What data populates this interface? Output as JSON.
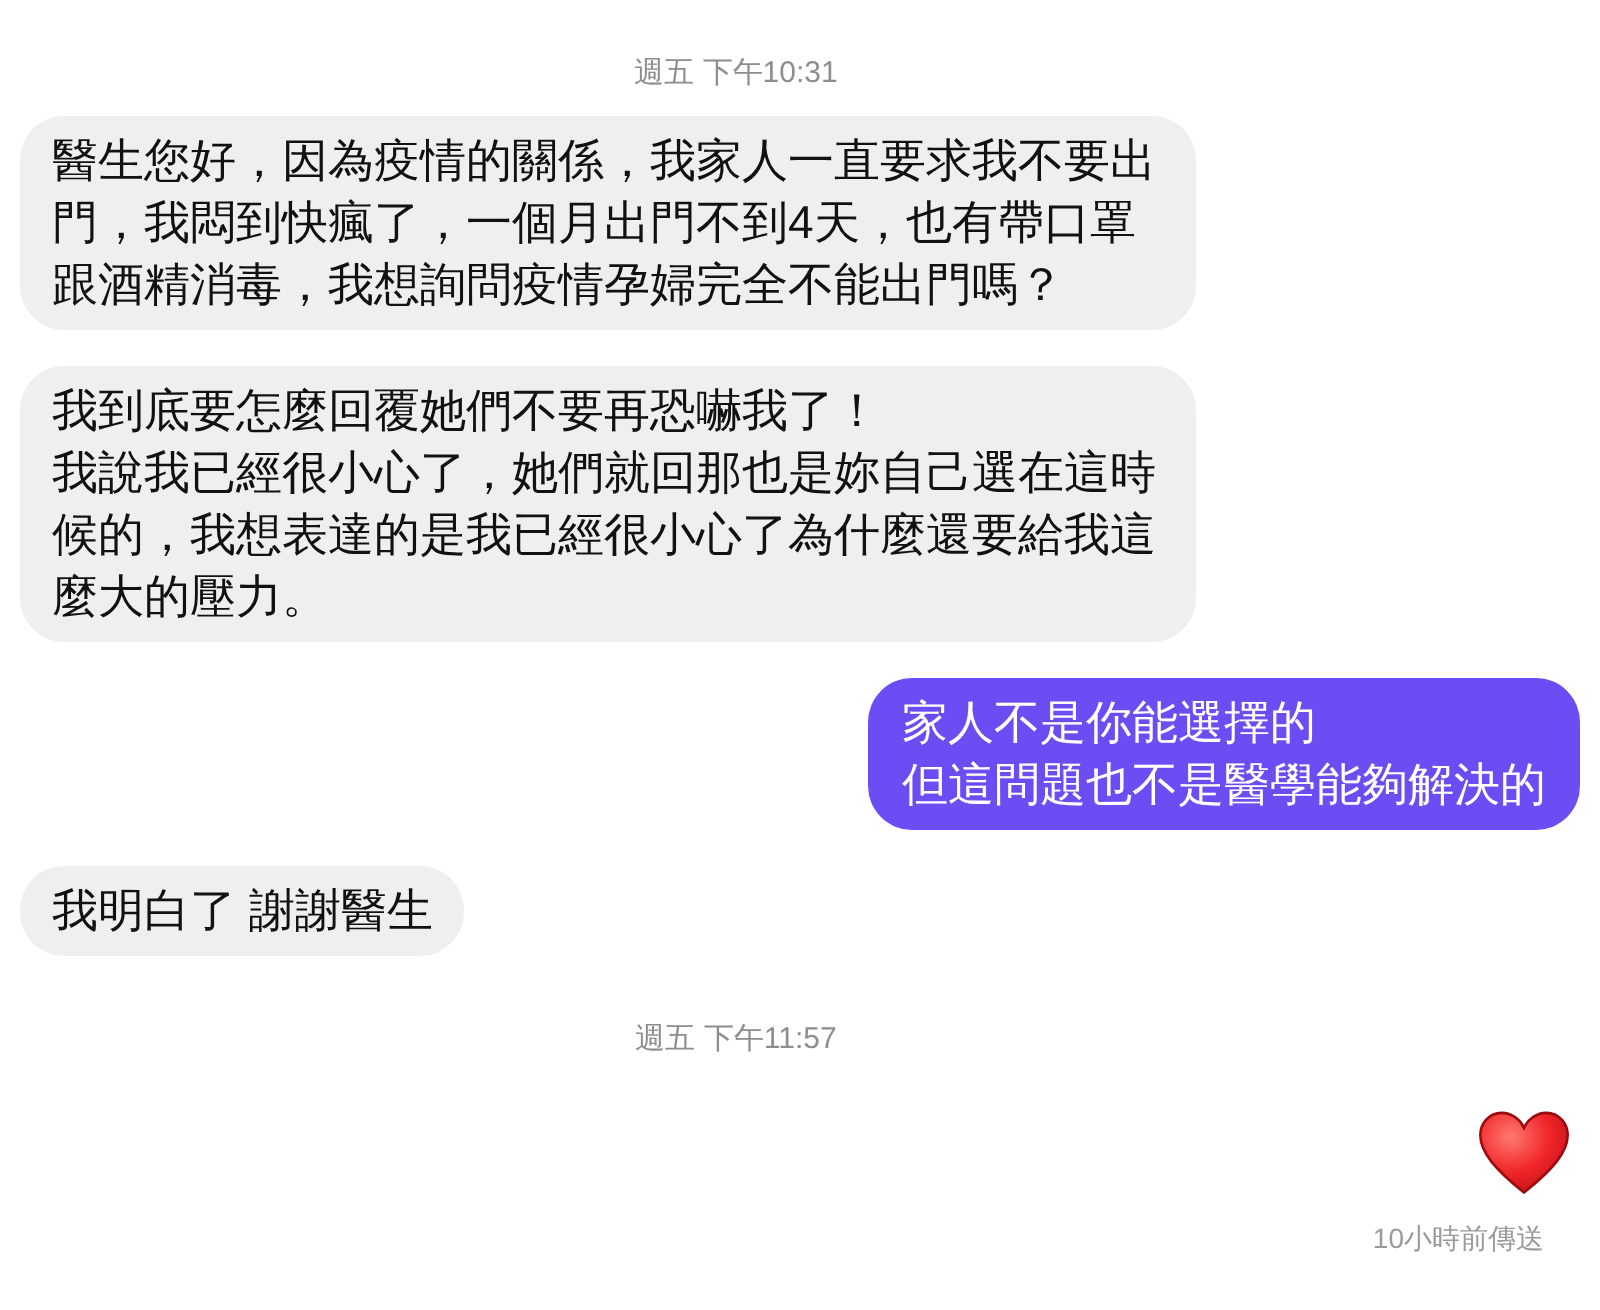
{
  "messages": [
    {
      "kind": "timestamp",
      "text": "週五 下午10:31"
    },
    {
      "kind": "received",
      "lines": [
        "醫生您好，因為疫情的關係，我家人一直要求我不要出門，我悶到快瘋了，一個月出門不到4天，也有帶口罩跟酒精消毒，我想詢問疫情孕婦完全不能出門嗎？"
      ]
    },
    {
      "kind": "received",
      "lines": [
        "我到底要怎麼回覆她們不要再恐嚇我了！",
        "我說我已經很小心了，她們就回那也是妳自己選在這時候的，我想表達的是我已經很小心了為什麼還要給我這麼大的壓力。"
      ]
    },
    {
      "kind": "sent",
      "lines": [
        "家人不是你能選擇的",
        "但這問題也不是醫學能夠解決的"
      ]
    },
    {
      "kind": "received",
      "lines": [
        "我明白了 謝謝醫生"
      ]
    },
    {
      "kind": "timestamp",
      "text": "週五 下午11:57"
    },
    {
      "kind": "heart"
    }
  ],
  "delivery_status": "10小時前傳送"
}
